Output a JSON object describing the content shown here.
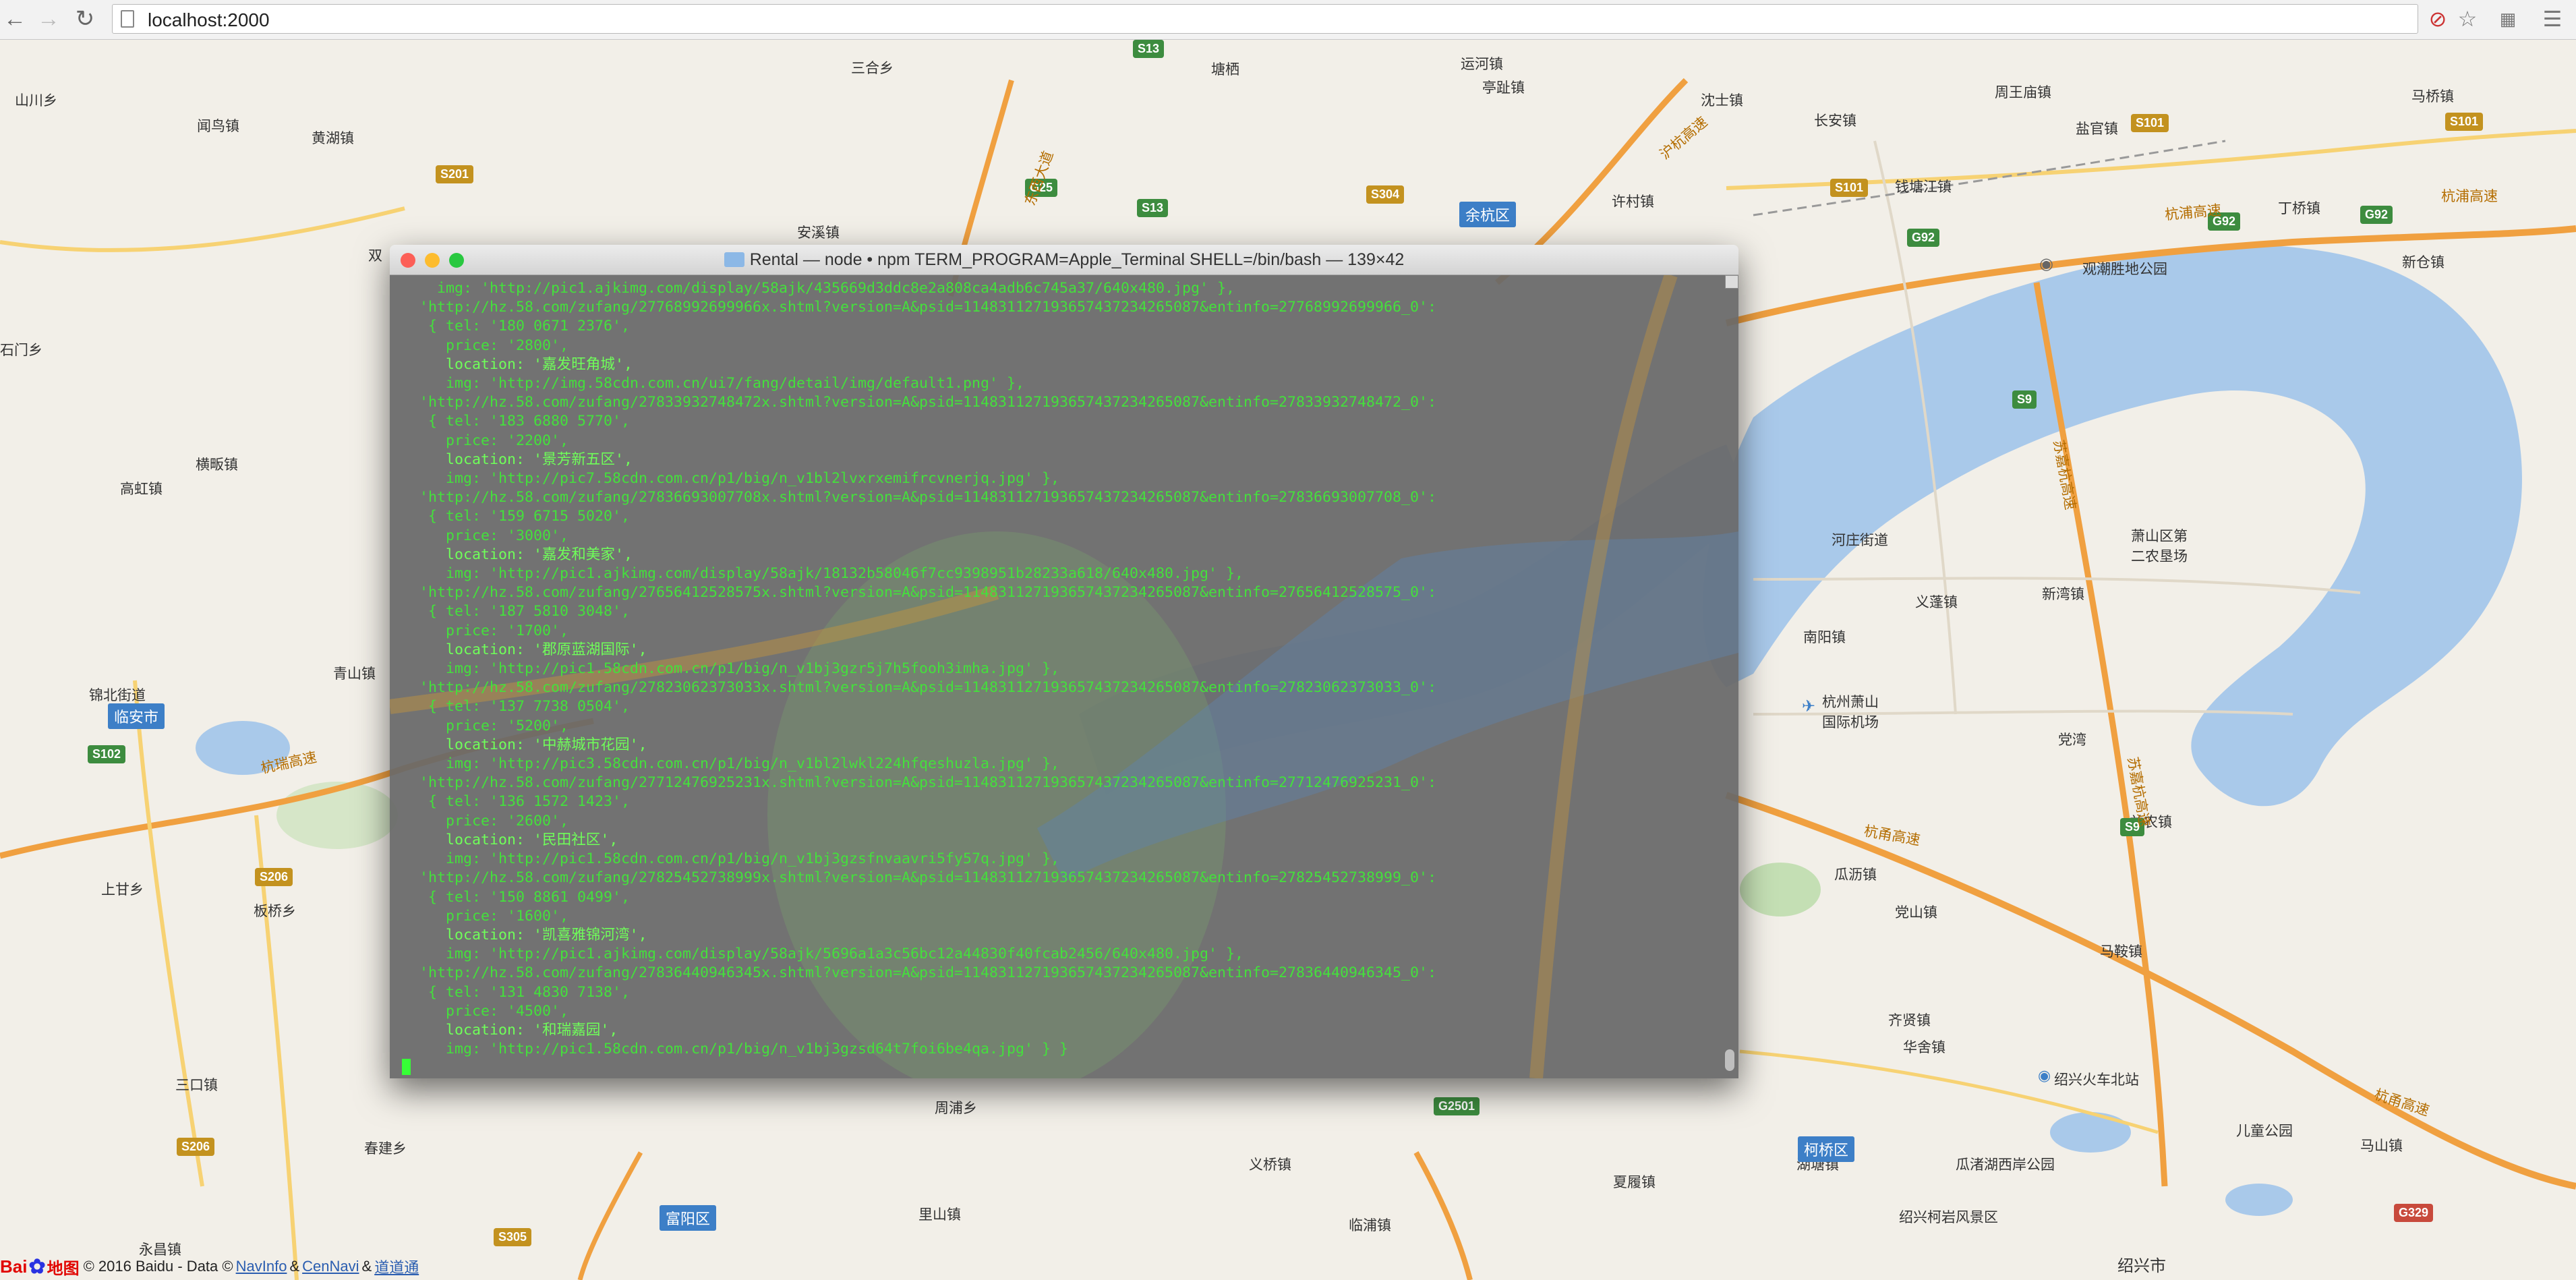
{
  "browser": {
    "url": "localhost:2000",
    "back_icon": "back-arrow-icon",
    "forward_icon": "forward-arrow-icon",
    "reload_icon": "reload-icon",
    "star_icon": "bookmark-star-icon",
    "menu_icon": "hamburger-menu-icon"
  },
  "map": {
    "places": [
      {
        "id": "shanchuan",
        "name": "山川乡"
      },
      {
        "id": "xunniao",
        "name": "闻鸟镇"
      },
      {
        "id": "huanghu",
        "name": "黄湖镇"
      },
      {
        "id": "sanhe",
        "name": "三合乡"
      },
      {
        "id": "tangqi",
        "name": "塘栖"
      },
      {
        "id": "yunhe",
        "name": "运河镇"
      },
      {
        "id": "tingzhi",
        "name": "亭趾镇"
      },
      {
        "id": "shitu",
        "name": "沈士镇"
      },
      {
        "id": "changan",
        "name": "长安镇"
      },
      {
        "id": "zhouwangmiao",
        "name": "周王庙镇"
      },
      {
        "id": "yanguan",
        "name": "盐官镇"
      },
      {
        "id": "maqiao",
        "name": "马桥镇"
      },
      {
        "id": "anxi",
        "name": "安溪镇"
      },
      {
        "id": "xucun",
        "name": "许村镇"
      },
      {
        "id": "qiantang",
        "name": "钱塘江镇"
      },
      {
        "id": "dingqiao",
        "name": "丁桥镇"
      },
      {
        "id": "xincang",
        "name": "新仓镇"
      },
      {
        "id": "shuang",
        "name": "双"
      },
      {
        "id": "shimen",
        "name": "石门乡"
      },
      {
        "id": "hengban",
        "name": "横畈镇"
      },
      {
        "id": "gaohong",
        "name": "高虹镇"
      },
      {
        "id": "jinbei",
        "name": "锦北街道"
      },
      {
        "id": "qingshan",
        "name": "青山镇"
      },
      {
        "id": "shanggan",
        "name": "上甘乡"
      },
      {
        "id": "banqiao",
        "name": "板桥乡"
      },
      {
        "id": "sankou",
        "name": "三口镇"
      },
      {
        "id": "chunjian",
        "name": "春建乡"
      },
      {
        "id": "yongchang",
        "name": "永昌镇"
      },
      {
        "id": "zhoupu",
        "name": "周浦乡"
      },
      {
        "id": "lishan",
        "name": "里山镇"
      },
      {
        "id": "yiqiao",
        "name": "义桥镇"
      },
      {
        "id": "linpu",
        "name": "临浦镇"
      },
      {
        "id": "xiaxiao",
        "name": "夏履镇"
      },
      {
        "id": "hezhuang",
        "name": "河庄街道"
      },
      {
        "id": "yipeng",
        "name": "义蓬镇"
      },
      {
        "id": "xiaoshan2",
        "name": "萧山区第\n二农垦场"
      },
      {
        "id": "xinwan",
        "name": "新湾镇"
      },
      {
        "id": "nanyang",
        "name": "南阳镇"
      },
      {
        "id": "airport",
        "name": "杭州萧山\n国际机场"
      },
      {
        "id": "dangwan",
        "name": "党湾"
      },
      {
        "id": "yinong",
        "name": "益农镇"
      },
      {
        "id": "guali",
        "name": "瓜沥镇"
      },
      {
        "id": "dangshan",
        "name": "党山镇"
      },
      {
        "id": "mashan",
        "name": "马鞍镇"
      },
      {
        "id": "huashe",
        "name": "华舍镇"
      },
      {
        "id": "qixian",
        "name": "齐贤镇"
      },
      {
        "id": "shaoxing_station",
        "name": "绍兴火车北站"
      },
      {
        "id": "hubu",
        "name": "湖塘镇"
      },
      {
        "id": "guazhu",
        "name": "瓜渚湖西岸公园"
      },
      {
        "id": "ertong",
        "name": "儿童公园"
      },
      {
        "id": "mashan2",
        "name": "马山镇"
      },
      {
        "id": "fengjing",
        "name": "绍兴柯岩风景区"
      },
      {
        "id": "shaoxing",
        "name": "绍兴市"
      },
      {
        "id": "guancha",
        "name": "观潮胜地公园"
      }
    ],
    "districts": [
      {
        "id": "yuhang",
        "name": "余杭区"
      },
      {
        "id": "linan",
        "name": "临安市"
      },
      {
        "id": "fuyang",
        "name": "富阳区"
      },
      {
        "id": "keqiao",
        "name": "柯桥区"
      }
    ],
    "roads": [
      {
        "id": "hangrui",
        "name": "杭瑞高速"
      },
      {
        "id": "hangpu1",
        "name": "杭浦高速"
      },
      {
        "id": "hangpu2",
        "name": "杭浦高速"
      },
      {
        "id": "hangpu3",
        "name": "杭浦高速"
      },
      {
        "id": "hangyong",
        "name": "杭甬高速"
      },
      {
        "id": "hangyong2",
        "name": "杭甬高速"
      },
      {
        "id": "sujia",
        "name": "苏嘉杭高速"
      },
      {
        "id": "sujia2",
        "name": "苏嘉杭高速"
      },
      {
        "id": "huhang",
        "name": "沪杭高速"
      },
      {
        "id": "dongshan",
        "name": "东西大道"
      }
    ],
    "shields": [
      {
        "id": "s201",
        "name": "S201"
      },
      {
        "id": "s13a",
        "name": "S13"
      },
      {
        "id": "g25",
        "name": "G25"
      },
      {
        "id": "s13b",
        "name": "S13"
      },
      {
        "id": "s304",
        "name": "S304"
      },
      {
        "id": "s101a",
        "name": "S101"
      },
      {
        "id": "s101b",
        "name": "S101"
      },
      {
        "id": "s101c",
        "name": "S101"
      },
      {
        "id": "g92a",
        "name": "G92"
      },
      {
        "id": "g92b",
        "name": "G92"
      },
      {
        "id": "g92c",
        "name": "G92"
      },
      {
        "id": "s9a",
        "name": "S9"
      },
      {
        "id": "s9b",
        "name": "S9"
      },
      {
        "id": "s102",
        "name": "S102"
      },
      {
        "id": "s206a",
        "name": "S206"
      },
      {
        "id": "s206b",
        "name": "S206"
      },
      {
        "id": "s305",
        "name": "S305"
      },
      {
        "id": "g2501",
        "name": "G2501"
      },
      {
        "id": "g329",
        "name": "G329"
      }
    ],
    "footer": {
      "logo_b1": "Bai",
      "logo_b2": "地图",
      "copyright": "© 2016 Baidu - Data ©",
      "link1": "NavInfo",
      "amp1": "&",
      "link2": "CenNavi",
      "amp2": "&",
      "link3": "道道通"
    }
  },
  "terminal": {
    "title": "Rental — node • npm TERM_PROGRAM=Apple_Terminal SHELL=/bin/bash — 139×42",
    "lines": [
      "    img: 'http://pic1.ajkimg.com/display/58ajk/435669d3ddc8e2a808ca4adb6c745a37/640x480.jpg' },",
      "  'http://hz.58.com/zufang/27768992699966x.shtml?version=A&psid=114831127193657437234265087&entinfo=27768992699966_0':",
      "   { tel: '180 0671 2376',",
      "     price: '2800',",
      "     location: '嘉发旺角城',",
      "     img: 'http://img.58cdn.com.cn/ui7/fang/detail/img/default1.png' },",
      "  'http://hz.58.com/zufang/27833932748472x.shtml?version=A&psid=114831127193657437234265087&entinfo=27833932748472_0':",
      "   { tel: '183 6880 5770',",
      "     price: '2200',",
      "     location: '景芳新五区',",
      "     img: 'http://pic7.58cdn.com.cn/p1/big/n_v1bl2lvxrxemifrcvnerjq.jpg' },",
      "  'http://hz.58.com/zufang/27836693007708x.shtml?version=A&psid=114831127193657437234265087&entinfo=27836693007708_0':",
      "   { tel: '159 6715 5020',",
      "     price: '3000',",
      "     location: '嘉发和美家',",
      "     img: 'http://pic1.ajkimg.com/display/58ajk/18132b58046f7cc9398951b28233a618/640x480.jpg' },",
      "  'http://hz.58.com/zufang/27656412528575x.shtml?version=A&psid=114831127193657437234265087&entinfo=27656412528575_0':",
      "   { tel: '187 5810 3048',",
      "     price: '1700',",
      "     location: '郡原蓝湖国际',",
      "     img: 'http://pic1.58cdn.com.cn/p1/big/n_v1bj3gzr5j7h5fooh3imha.jpg' },",
      "  'http://hz.58.com/zufang/27823062373033x.shtml?version=A&psid=114831127193657437234265087&entinfo=27823062373033_0':",
      "   { tel: '137 7738 0504',",
      "     price: '5200',",
      "     location: '中赫城市花园',",
      "     img: 'http://pic3.58cdn.com.cn/p1/big/n_v1bl2lwkl224hfqeshuzla.jpg' },",
      "  'http://hz.58.com/zufang/27712476925231x.shtml?version=A&psid=114831127193657437234265087&entinfo=27712476925231_0':",
      "   { tel: '136 1572 1423',",
      "     price: '2600',",
      "     location: '民田社区',",
      "     img: 'http://pic1.58cdn.com.cn/p1/big/n_v1bj3gzsfnvaavri5fy57q.jpg' },",
      "  'http://hz.58.com/zufang/27825452738999x.shtml?version=A&psid=114831127193657437234265087&entinfo=27825452738999_0':",
      "   { tel: '150 8861 0499',",
      "     price: '1600',",
      "     location: '凯喜雅锦河湾',",
      "     img: 'http://pic1.ajkimg.com/display/58ajk/5696a1a3c56bc12a44830f40fcab2456/640x480.jpg' },",
      "  'http://hz.58.com/zufang/27836440946345x.shtml?version=A&psid=114831127193657437234265087&entinfo=27836440946345_0':",
      "   { tel: '131 4830 7138',",
      "     price: '4500',",
      "     location: '和瑞嘉园',",
      "     img: 'http://pic1.58cdn.com.cn/p1/big/n_v1bj3gzsd64t7foi6be4qa.jpg' } }"
    ]
  }
}
